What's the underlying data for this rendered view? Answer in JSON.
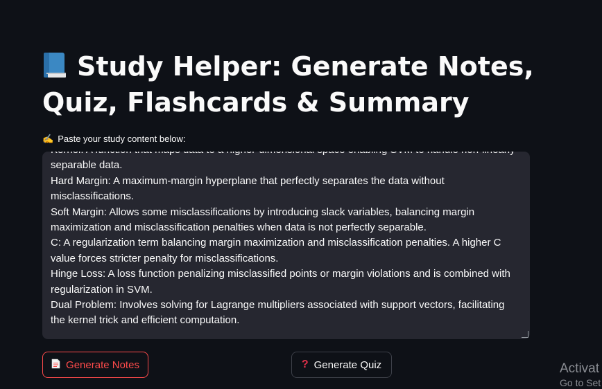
{
  "app": {
    "title": "Study Helper: Generate Notes, Quiz, Flashcards & Summary"
  },
  "input": {
    "label": "Paste your study content below:",
    "value_lines": [
      "Kernel: A function that maps data to a higher-dimensional space enabling SVM to handle non-linearly separable data.",
      "Hard Margin: A maximum-margin hyperplane that perfectly separates the data without misclassifications.",
      "Soft Margin: Allows some misclassifications by introducing slack variables, balancing margin maximization and misclassification penalties when data is not perfectly separable.",
      "C: A regularization term balancing margin maximization and misclassification penalties. A higher C value forces stricter penalty for misclassifications.",
      "Hinge Loss: A loss function penalizing misclassified points or margin violations and is combined with regularization in SVM.",
      "Dual Problem: Involves solving for Lagrange multipliers associated with support vectors, facilitating the kernel trick and efficient computation."
    ]
  },
  "buttons": {
    "notes_label": "Generate Notes",
    "quiz_label": "Generate Quiz"
  },
  "icons": {
    "title": "blue-book-icon",
    "label": "writing-hand-icon",
    "notes": "page-icon",
    "quiz": "question-mark-icon"
  },
  "colors": {
    "background": "#0e1117",
    "input_bg": "#262730",
    "primary": "#ff4b4b",
    "text": "#fafafa"
  },
  "watermark": {
    "line1": "Activat",
    "line2": "Go to Set"
  }
}
